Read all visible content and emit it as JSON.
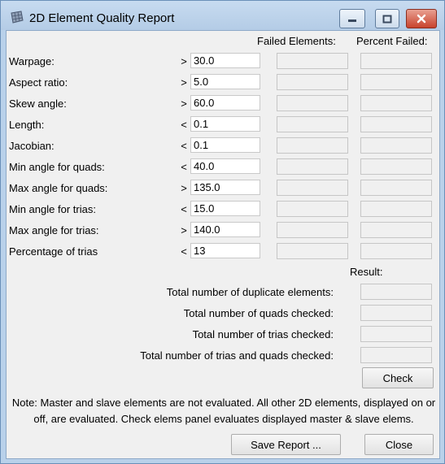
{
  "window": {
    "title": "2D Element Quality Report",
    "icon": "grid-mesh-icon",
    "controls": [
      "minimize-icon",
      "maximize-icon",
      "close-icon"
    ]
  },
  "headers": {
    "failed": "Failed Elements:",
    "percent": "Percent Failed:",
    "result": "Result:"
  },
  "criteria": [
    {
      "label": "Warpage:",
      "op": ">",
      "value": "30.0"
    },
    {
      "label": "Aspect ratio:",
      "op": ">",
      "value": "5.0"
    },
    {
      "label": "Skew angle:",
      "op": ">",
      "value": "60.0"
    },
    {
      "label": "Length:",
      "op": "<",
      "value": "0.1"
    },
    {
      "label": "Jacobian:",
      "op": "<",
      "value": "0.1"
    },
    {
      "label": "Min angle for quads:",
      "op": "<",
      "value": "40.0"
    },
    {
      "label": "Max angle for quads:",
      "op": ">",
      "value": "135.0"
    },
    {
      "label": "Min angle for trias:",
      "op": "<",
      "value": "15.0"
    },
    {
      "label": "Max angle for trias:",
      "op": ">",
      "value": "140.0"
    },
    {
      "label": "Percentage of trias",
      "op": "<",
      "value": "13"
    }
  ],
  "totals": [
    {
      "label": "Total number of duplicate elements:"
    },
    {
      "label": "Total number of quads checked:"
    },
    {
      "label": "Total number of trias checked:"
    },
    {
      "label": "Total number of trias and quads checked:"
    }
  ],
  "buttons": {
    "check": "Check",
    "save_report": "Save Report ...",
    "close": "Close"
  },
  "note": "Note: Master and slave elements are not evaluated. All other 2D elements, displayed on or off, are evaluated. Check elems panel evaluates displayed master & slave elems."
}
